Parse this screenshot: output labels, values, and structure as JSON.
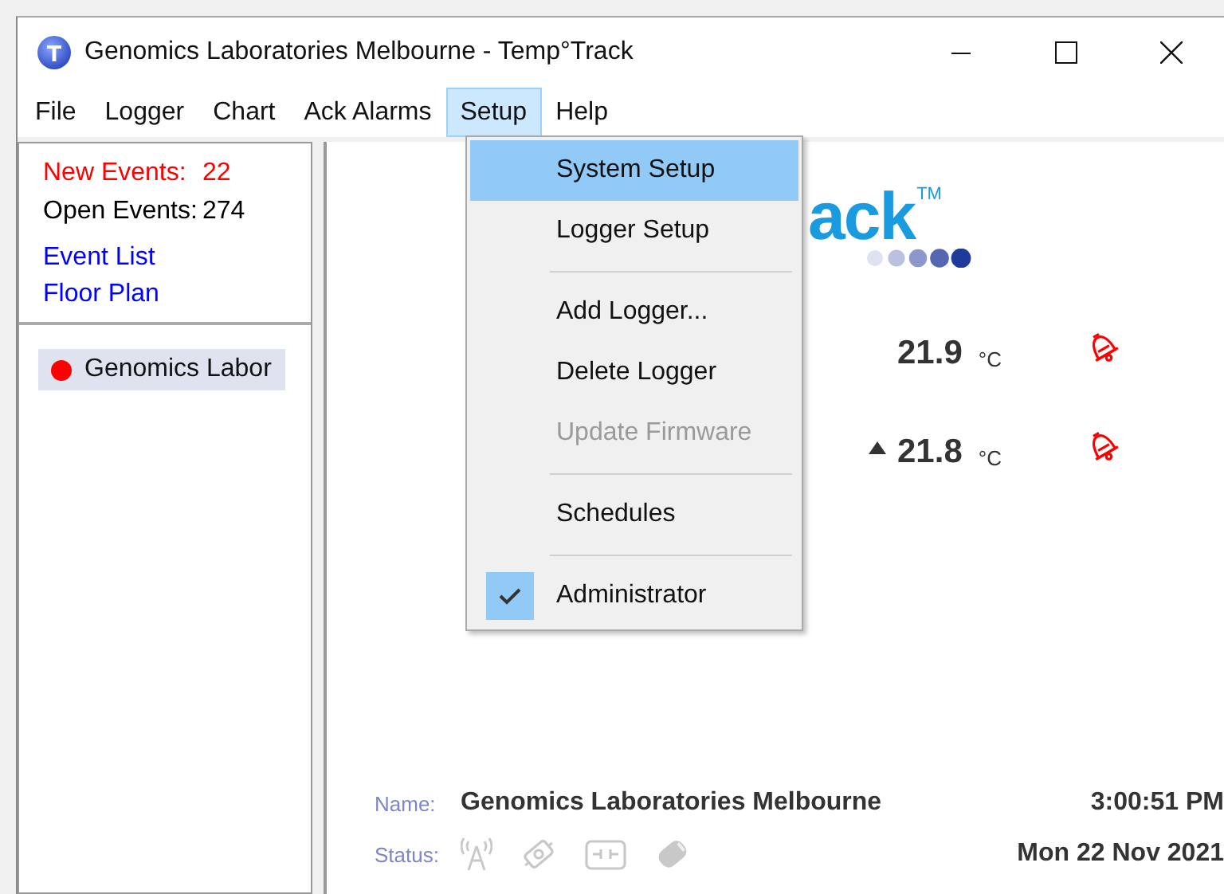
{
  "window": {
    "title": "Genomics Laboratories Melbourne - Temp°Track"
  },
  "menu_bar": [
    {
      "label": "File",
      "selected": false
    },
    {
      "label": "Logger",
      "selected": false
    },
    {
      "label": "Chart",
      "selected": false
    },
    {
      "label": "Ack Alarms",
      "selected": false
    },
    {
      "label": "Setup",
      "selected": true
    },
    {
      "label": "Help",
      "selected": false
    }
  ],
  "setup_menu": [
    {
      "kind": "item",
      "label": "System Setup",
      "highlighted": true,
      "disabled": false,
      "checked": false
    },
    {
      "kind": "item",
      "label": "Logger Setup",
      "highlighted": false,
      "disabled": false,
      "checked": false
    },
    {
      "kind": "separator"
    },
    {
      "kind": "item",
      "label": "Add Logger...",
      "highlighted": false,
      "disabled": false,
      "checked": false
    },
    {
      "kind": "item",
      "label": "Delete Logger",
      "highlighted": false,
      "disabled": false,
      "checked": false
    },
    {
      "kind": "item",
      "label": "Update Firmware",
      "highlighted": false,
      "disabled": true,
      "checked": false
    },
    {
      "kind": "separator"
    },
    {
      "kind": "item",
      "label": "Schedules",
      "highlighted": false,
      "disabled": false,
      "checked": false
    },
    {
      "kind": "separator"
    },
    {
      "kind": "item",
      "label": "Administrator",
      "highlighted": false,
      "disabled": false,
      "checked": true
    }
  ],
  "sidebar": {
    "new_events_label": "New Events:",
    "new_events_count": "22",
    "open_events_label": "Open Events:",
    "open_events_count": "274",
    "links": [
      "Event List",
      "Floor Plan"
    ],
    "tree": [
      {
        "label": "Genomics Labor",
        "color": "#ff0000",
        "selected": true
      }
    ]
  },
  "logo": {
    "text": "ack",
    "trademark": "TM"
  },
  "readings": [
    {
      "rising": false,
      "value": "21.9",
      "unit": "°C",
      "alarm": true
    },
    {
      "rising": true,
      "value": "21.8",
      "unit": "°C",
      "alarm": true
    }
  ],
  "details": {
    "name_label": "Name:",
    "name": "Genomics Laboratories Melbourne",
    "time": "3:00:51 PM",
    "status_label": "Status:",
    "date": "Mon 22 Nov 2021"
  }
}
